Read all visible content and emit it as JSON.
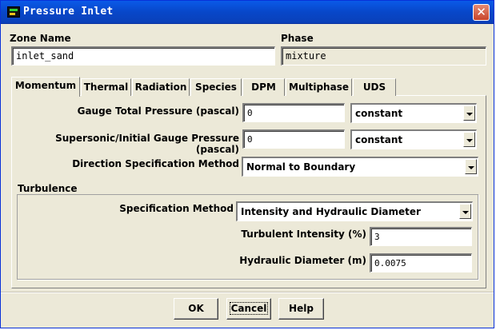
{
  "window": {
    "title": "Pressure Inlet"
  },
  "zone": {
    "label": "Zone Name",
    "value": "inlet_sand"
  },
  "phase": {
    "label": "Phase",
    "value": "mixture"
  },
  "tabs": [
    "Momentum",
    "Thermal",
    "Radiation",
    "Species",
    "DPM",
    "Multiphase",
    "UDS"
  ],
  "active_tab": "Momentum",
  "momentum": {
    "gauge_total_pressure": {
      "label": "Gauge Total Pressure (pascal)",
      "value": "0",
      "profile": "constant"
    },
    "supersonic_pressure": {
      "label": "Supersonic/Initial Gauge Pressure (pascal)",
      "value": "0",
      "profile": "constant"
    },
    "direction_method": {
      "label": "Direction Specification Method",
      "value": "Normal to Boundary"
    }
  },
  "turbulence": {
    "title": "Turbulence",
    "spec_method": {
      "label": "Specification Method",
      "value": "Intensity and Hydraulic Diameter"
    },
    "intensity": {
      "label": "Turbulent Intensity (%)",
      "value": "3"
    },
    "hydraulic_diameter": {
      "label": "Hydraulic Diameter (m)",
      "value": "0.0075"
    }
  },
  "buttons": {
    "ok": "OK",
    "cancel": "Cancel",
    "help": "Help"
  },
  "icons": {
    "app": "app-icon",
    "close": "close-icon",
    "dropdown": "chevron-down-icon"
  }
}
